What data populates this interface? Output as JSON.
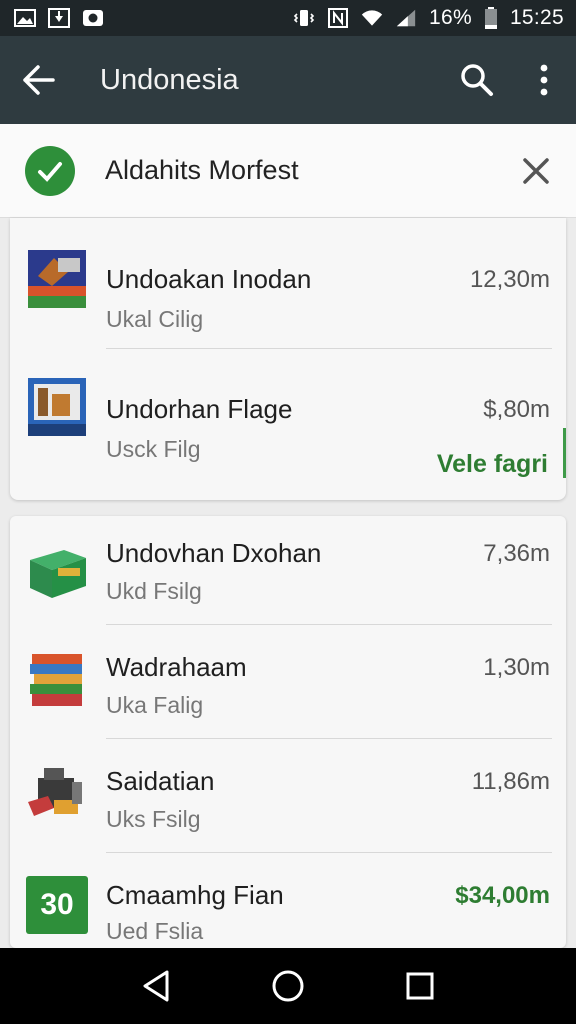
{
  "status_bar": {
    "battery": "16%",
    "time": "15:25",
    "icons": [
      "image-icon",
      "download-icon",
      "camera-icon",
      "vibrate-icon",
      "nfc-icon",
      "wifi-icon",
      "signal-icon",
      "battery-icon"
    ]
  },
  "app_bar": {
    "title": "Undonesia",
    "icons": [
      "back-arrow-icon",
      "search-icon",
      "more-vert-icon"
    ]
  },
  "notice": {
    "text": "Aldahits Morfest"
  },
  "card1": {
    "items": [
      {
        "name": "Undoakan Inodan",
        "sub": "Ukal Cilig",
        "price": "12,30m",
        "icon": "product-box-icon"
      },
      {
        "name": "Undorhan Flage",
        "sub": "Usck Filg",
        "price": "$,80m",
        "icon": "product-box-icon"
      }
    ],
    "link": "Vele fagri"
  },
  "card2": {
    "items": [
      {
        "name": "Undovhan Dxohan",
        "sub": "Ukd Fsilg",
        "price": "7,36m",
        "icon": "green-box-icon"
      },
      {
        "name": "Wadrahaam",
        "sub": "Uka Falig",
        "price": "1,30m",
        "icon": "book-stack-icon"
      },
      {
        "name": "Saidatian",
        "sub": "Uks Fsilg",
        "price": "11,86m",
        "icon": "machine-icon"
      },
      {
        "name": "Cmaamhg Fian",
        "sub": "Ued Fslia",
        "price": "$34,00m",
        "icon": "badge-30-icon",
        "badge": "30"
      }
    ]
  },
  "colors": {
    "status_bar": "#1f2629",
    "app_bar": "#2f3b40",
    "accent_green": "#2e7d32"
  }
}
